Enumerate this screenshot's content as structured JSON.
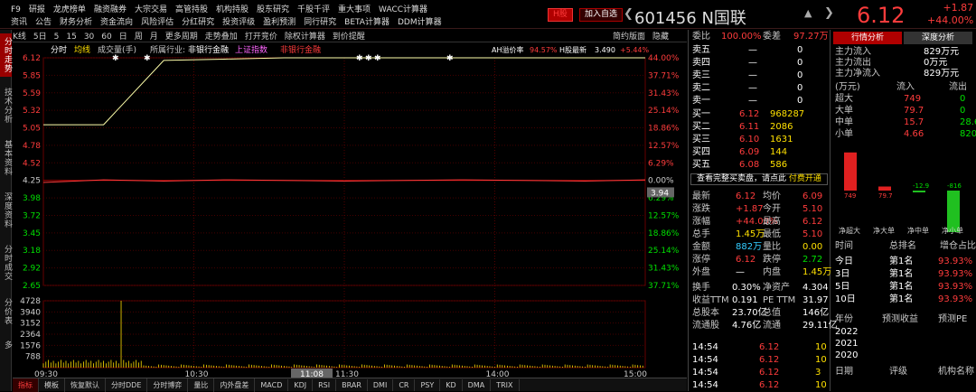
{
  "menu": {
    "row1": [
      "F9",
      "研报",
      "龙虎榜单",
      "融资融券",
      "大宗交易",
      "高管持股",
      "机构持股",
      "股东研究",
      "千股千评",
      "重大事项",
      "WACC计算器"
    ],
    "row2": [
      "资讯",
      "公告",
      "财务分析",
      "资金流向",
      "风险评估",
      "分红研究",
      "投资评级",
      "盈利预测",
      "同行研究",
      "BETA计算器",
      "DDM计算器"
    ]
  },
  "header": {
    "hshare": "H股",
    "add_watch": "加入自选",
    "code": "601456",
    "name": "N国联",
    "price": "6.12",
    "change": "+1.87",
    "change_pct": "+44.00%"
  },
  "side_tabs": [
    "分时走势",
    "技术分析",
    "基本资料",
    "深度资料",
    "分时成交",
    "分价表",
    "多"
  ],
  "chart_toolbar": [
    "K线",
    "5日",
    "5",
    "15",
    "30",
    "60",
    "日",
    "周",
    "月",
    "更多周期",
    "走势叠加",
    "打开竞价",
    "除权计算器",
    "到价提醒"
  ],
  "chart_toolbar_right": [
    "简约版面",
    "隐藏"
  ],
  "chart_legend": {
    "fenshi": "分时",
    "junxian": "均线",
    "vol": "成交量(手)",
    "industry": "所属行业:",
    "bank": "非银行金融",
    "sh": "上证指数",
    "bank2": "非银行金融",
    "ah": "AH溢价率",
    "ah_val": "94.57%",
    "hnew": "H股最新",
    "hnew_val": "3.490",
    "hnew_pct": "+5.44%"
  },
  "chart_data": {
    "type": "line",
    "price_left": [
      "6.12",
      "5.85",
      "5.59",
      "5.32",
      "5.05",
      "4.78",
      "4.52",
      "4.25",
      "3.98",
      "3.72",
      "3.45",
      "3.18",
      "2.92",
      "2.65"
    ],
    "pct_right": [
      "44.00%",
      "37.71%",
      "31.43%",
      "25.14%",
      "18.86%",
      "12.57%",
      "6.29%",
      "0.00%",
      "6.29%",
      "12.57%",
      "18.86%",
      "25.14%",
      "31.43%",
      "37.71%"
    ],
    "cur_marker": "3.94",
    "vol_ticks": [
      "4728",
      "3940",
      "3152",
      "2364",
      "1576",
      "788"
    ],
    "times": [
      "09:30",
      "10:30",
      "11:30",
      "14:00",
      "15:00"
    ],
    "cursor_time": "11:08",
    "prev_close": 4.25,
    "series": [
      {
        "values": [
          5.1,
          5.1,
          6.08,
          6.1,
          6.12,
          6.12,
          6.12,
          6.12,
          6.12,
          6.12,
          6.12
        ]
      },
      {
        "values": [
          4.22,
          4.26,
          4.24,
          4.26,
          4.25,
          4.24,
          4.25,
          4.26,
          4.25,
          4.24,
          4.26
        ]
      }
    ]
  },
  "bottom_tabs": [
    "指标",
    "模板",
    "恢复默认",
    "分时DDE",
    "分时博弈",
    "量比",
    "内外盘差",
    "MACD",
    "KDJ",
    "RSI",
    "BRAR",
    "DMI",
    "CR",
    "PSY",
    "KD",
    "DMA",
    "TRIX"
  ],
  "orderbook": {
    "weibi_l": "委比",
    "weibi": "100.00%",
    "weicha_l": "委差",
    "weicha": "97.27万",
    "sells": [
      [
        "卖五",
        "—",
        "0"
      ],
      [
        "卖四",
        "—",
        "0"
      ],
      [
        "卖三",
        "—",
        "0"
      ],
      [
        "卖二",
        "—",
        "0"
      ],
      [
        "卖一",
        "—",
        "0"
      ]
    ],
    "buys": [
      [
        "买一",
        "6.12",
        "968287"
      ],
      [
        "买二",
        "6.11",
        "2086"
      ],
      [
        "买三",
        "6.10",
        "1631"
      ],
      [
        "买四",
        "6.09",
        "144"
      ],
      [
        "买五",
        "6.08",
        "586"
      ]
    ],
    "full_text": "查看完整买卖盘，请点此",
    "paid": "付费开通"
  },
  "quote": [
    [
      "最新",
      "6.12",
      "均价",
      "6.09"
    ],
    [
      "涨跌",
      "+1.87",
      "今开",
      "5.10"
    ],
    [
      "涨幅",
      "+44.00%",
      "最高",
      "6.12"
    ],
    [
      "总手",
      "1.45万",
      "最低",
      "5.10"
    ],
    [
      "金额",
      "882万",
      "量比",
      "0.00"
    ],
    [
      "涨停",
      "6.12",
      "跌停",
      "2.72"
    ],
    [
      "外盘",
      "—",
      "内盘",
      "1.45万"
    ]
  ],
  "quote2": [
    [
      "换手",
      "0.30%",
      "净资产",
      "4.304"
    ],
    [
      "收益TTM",
      "0.191",
      "PE TTM",
      "31.97"
    ],
    [
      "总股本",
      "23.70亿",
      "总值",
      "146亿"
    ],
    [
      "流通股",
      "4.76亿",
      "流通",
      "29.11亿"
    ]
  ],
  "ticks": [
    [
      "14:54",
      "6.12",
      "10"
    ],
    [
      "14:54",
      "6.12",
      "10"
    ],
    [
      "14:54",
      "6.12",
      "3"
    ],
    [
      "14:54",
      "6.12",
      "10"
    ]
  ],
  "right": {
    "tab1": "行情分析",
    "tab2": "深度分析",
    "flows": [
      [
        "主力流入",
        "829万元"
      ],
      [
        "主力流出",
        "0万元"
      ],
      [
        "主力净流入",
        "829万元"
      ]
    ],
    "unit": "(万元)",
    "in_l": "流入",
    "out_l": "流出",
    "big": [
      [
        "超大",
        "749",
        "0"
      ],
      [
        "大单",
        "79.7",
        "0"
      ],
      [
        "中单",
        "15.7",
        "28.6"
      ],
      [
        "小单",
        "4.66",
        "820"
      ]
    ],
    "bars": [
      {
        "label": "净超大",
        "value": 749
      },
      {
        "label": "净大单",
        "value": 79.7
      },
      {
        "label": "净中单",
        "value": -12.9
      },
      {
        "label": "净小单",
        "value": -816
      }
    ],
    "rank_head": [
      "时间",
      "总排名",
      "增仓占比"
    ],
    "ranks": [
      [
        "今日",
        "第1名",
        "93.93%"
      ],
      [
        "3日",
        "第1名",
        "93.93%"
      ],
      [
        "5日",
        "第1名",
        "93.93%"
      ],
      [
        "10日",
        "第1名",
        "93.93%"
      ]
    ],
    "fc_head": [
      "年份",
      "预测收益",
      "预测PE"
    ],
    "years": [
      "2022",
      "2021",
      "2020"
    ],
    "rating_head": [
      "日期",
      "评级",
      "机构名称"
    ]
  }
}
